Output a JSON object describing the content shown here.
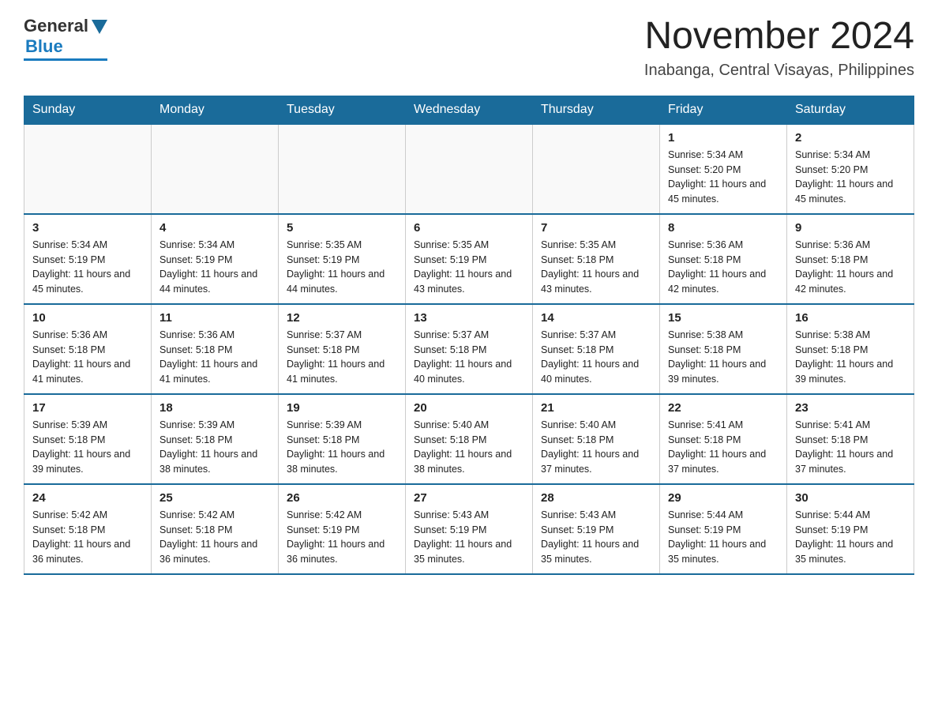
{
  "logo": {
    "general": "General",
    "blue": "Blue"
  },
  "title": "November 2024",
  "subtitle": "Inabanga, Central Visayas, Philippines",
  "days_header": [
    "Sunday",
    "Monday",
    "Tuesday",
    "Wednesday",
    "Thursday",
    "Friday",
    "Saturday"
  ],
  "weeks": [
    [
      {
        "day": "",
        "info": ""
      },
      {
        "day": "",
        "info": ""
      },
      {
        "day": "",
        "info": ""
      },
      {
        "day": "",
        "info": ""
      },
      {
        "day": "",
        "info": ""
      },
      {
        "day": "1",
        "info": "Sunrise: 5:34 AM\nSunset: 5:20 PM\nDaylight: 11 hours and 45 minutes."
      },
      {
        "day": "2",
        "info": "Sunrise: 5:34 AM\nSunset: 5:20 PM\nDaylight: 11 hours and 45 minutes."
      }
    ],
    [
      {
        "day": "3",
        "info": "Sunrise: 5:34 AM\nSunset: 5:19 PM\nDaylight: 11 hours and 45 minutes."
      },
      {
        "day": "4",
        "info": "Sunrise: 5:34 AM\nSunset: 5:19 PM\nDaylight: 11 hours and 44 minutes."
      },
      {
        "day": "5",
        "info": "Sunrise: 5:35 AM\nSunset: 5:19 PM\nDaylight: 11 hours and 44 minutes."
      },
      {
        "day": "6",
        "info": "Sunrise: 5:35 AM\nSunset: 5:19 PM\nDaylight: 11 hours and 43 minutes."
      },
      {
        "day": "7",
        "info": "Sunrise: 5:35 AM\nSunset: 5:18 PM\nDaylight: 11 hours and 43 minutes."
      },
      {
        "day": "8",
        "info": "Sunrise: 5:36 AM\nSunset: 5:18 PM\nDaylight: 11 hours and 42 minutes."
      },
      {
        "day": "9",
        "info": "Sunrise: 5:36 AM\nSunset: 5:18 PM\nDaylight: 11 hours and 42 minutes."
      }
    ],
    [
      {
        "day": "10",
        "info": "Sunrise: 5:36 AM\nSunset: 5:18 PM\nDaylight: 11 hours and 41 minutes."
      },
      {
        "day": "11",
        "info": "Sunrise: 5:36 AM\nSunset: 5:18 PM\nDaylight: 11 hours and 41 minutes."
      },
      {
        "day": "12",
        "info": "Sunrise: 5:37 AM\nSunset: 5:18 PM\nDaylight: 11 hours and 41 minutes."
      },
      {
        "day": "13",
        "info": "Sunrise: 5:37 AM\nSunset: 5:18 PM\nDaylight: 11 hours and 40 minutes."
      },
      {
        "day": "14",
        "info": "Sunrise: 5:37 AM\nSunset: 5:18 PM\nDaylight: 11 hours and 40 minutes."
      },
      {
        "day": "15",
        "info": "Sunrise: 5:38 AM\nSunset: 5:18 PM\nDaylight: 11 hours and 39 minutes."
      },
      {
        "day": "16",
        "info": "Sunrise: 5:38 AM\nSunset: 5:18 PM\nDaylight: 11 hours and 39 minutes."
      }
    ],
    [
      {
        "day": "17",
        "info": "Sunrise: 5:39 AM\nSunset: 5:18 PM\nDaylight: 11 hours and 39 minutes."
      },
      {
        "day": "18",
        "info": "Sunrise: 5:39 AM\nSunset: 5:18 PM\nDaylight: 11 hours and 38 minutes."
      },
      {
        "day": "19",
        "info": "Sunrise: 5:39 AM\nSunset: 5:18 PM\nDaylight: 11 hours and 38 minutes."
      },
      {
        "day": "20",
        "info": "Sunrise: 5:40 AM\nSunset: 5:18 PM\nDaylight: 11 hours and 38 minutes."
      },
      {
        "day": "21",
        "info": "Sunrise: 5:40 AM\nSunset: 5:18 PM\nDaylight: 11 hours and 37 minutes."
      },
      {
        "day": "22",
        "info": "Sunrise: 5:41 AM\nSunset: 5:18 PM\nDaylight: 11 hours and 37 minutes."
      },
      {
        "day": "23",
        "info": "Sunrise: 5:41 AM\nSunset: 5:18 PM\nDaylight: 11 hours and 37 minutes."
      }
    ],
    [
      {
        "day": "24",
        "info": "Sunrise: 5:42 AM\nSunset: 5:18 PM\nDaylight: 11 hours and 36 minutes."
      },
      {
        "day": "25",
        "info": "Sunrise: 5:42 AM\nSunset: 5:18 PM\nDaylight: 11 hours and 36 minutes."
      },
      {
        "day": "26",
        "info": "Sunrise: 5:42 AM\nSunset: 5:19 PM\nDaylight: 11 hours and 36 minutes."
      },
      {
        "day": "27",
        "info": "Sunrise: 5:43 AM\nSunset: 5:19 PM\nDaylight: 11 hours and 35 minutes."
      },
      {
        "day": "28",
        "info": "Sunrise: 5:43 AM\nSunset: 5:19 PM\nDaylight: 11 hours and 35 minutes."
      },
      {
        "day": "29",
        "info": "Sunrise: 5:44 AM\nSunset: 5:19 PM\nDaylight: 11 hours and 35 minutes."
      },
      {
        "day": "30",
        "info": "Sunrise: 5:44 AM\nSunset: 5:19 PM\nDaylight: 11 hours and 35 minutes."
      }
    ]
  ]
}
